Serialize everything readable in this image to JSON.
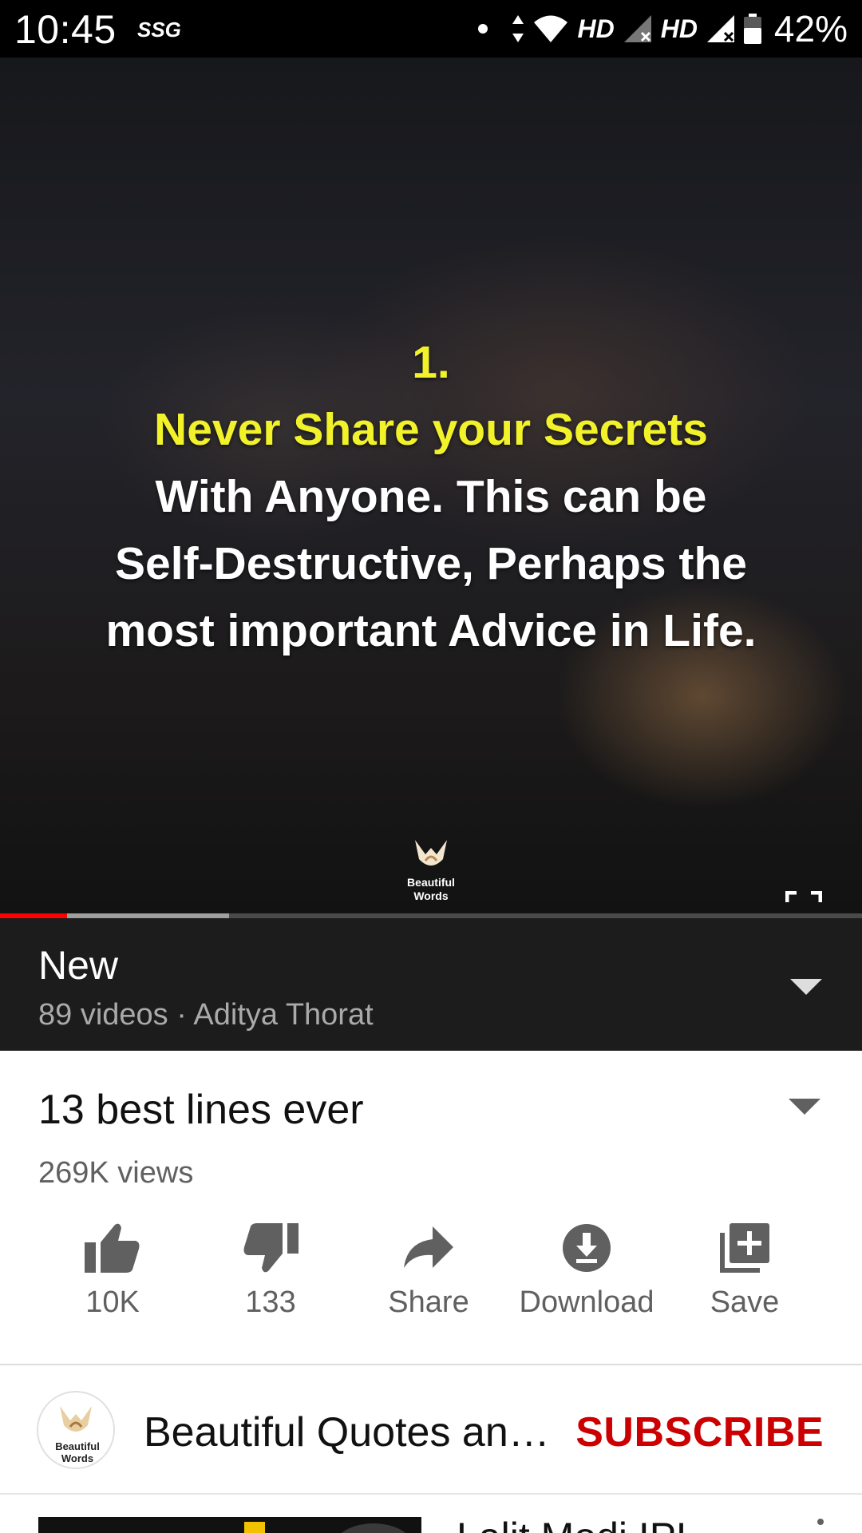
{
  "status_bar": {
    "time": "10:45",
    "carrier_tag": "SSG",
    "network_1": "HD",
    "network_2": "HD",
    "battery_percent": "42%",
    "icons": [
      "notification-dot-icon",
      "data-arrows-icon",
      "wifi-icon",
      "signal-1-icon",
      "signal-2-icon",
      "battery-icon"
    ]
  },
  "video": {
    "overlay_lines": [
      "1.",
      "Never Share your Secrets",
      "With Anyone. This can be",
      "Self-Destructive, Perhaps the",
      "most important Advice in Life."
    ],
    "watermark_text": "Beautiful Words",
    "playback_fraction": 0.078,
    "buffered_fraction": 0.266,
    "colors": {
      "highlight": "#f2f22a",
      "progress": "#ff0000"
    }
  },
  "playlist": {
    "title": "New",
    "meta": "89 videos · Aditya Thorat"
  },
  "video_info": {
    "title": "13 best lines ever",
    "views": "269K views"
  },
  "actions": [
    {
      "id": "like",
      "label": "10K",
      "icon": "thumbs-up-icon"
    },
    {
      "id": "dislike",
      "label": "133",
      "icon": "thumbs-down-icon"
    },
    {
      "id": "share",
      "label": "Share",
      "icon": "share-icon"
    },
    {
      "id": "download",
      "label": "Download",
      "icon": "download-icon"
    },
    {
      "id": "save",
      "label": "Save",
      "icon": "add-to-playlist-icon"
    }
  ],
  "channel": {
    "name": "Beautiful Quotes an…",
    "avatar_text": "Beautiful Words",
    "subscribe_label": "SUBSCRIBE",
    "subscribe_color": "#cc0000"
  },
  "next_video": {
    "title": "Lalit Modi IPL"
  }
}
